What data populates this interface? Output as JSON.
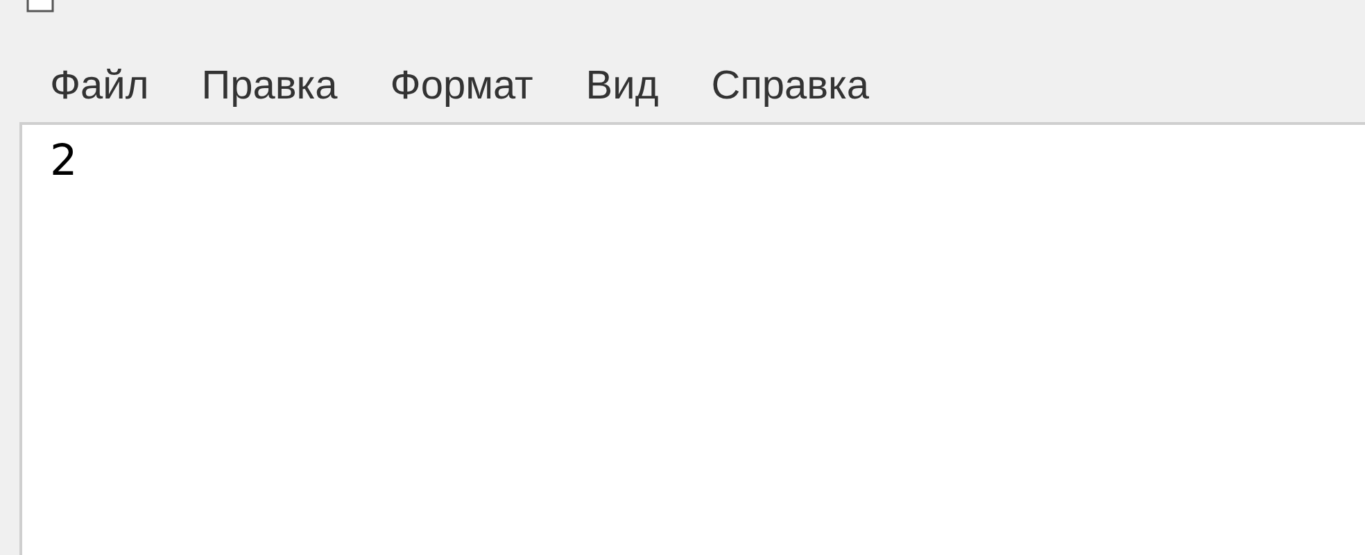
{
  "menu": [
    {
      "label": "Файл"
    },
    {
      "label": "Правка"
    },
    {
      "label": "Формат"
    },
    {
      "label": "Вид"
    },
    {
      "label": "Справка"
    }
  ],
  "editor": {
    "value": "2"
  }
}
